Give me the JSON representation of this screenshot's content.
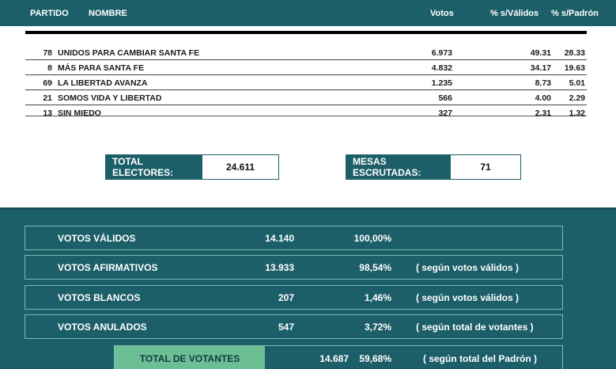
{
  "header": {
    "col_partido": "PARTIDO",
    "col_nombre": "NOMBRE",
    "col_votos": "Votos",
    "col_pct_validos": "% s/Válidos",
    "col_pct_padron": "% s/Padrón"
  },
  "results": [
    {
      "num": "78",
      "name": "UNIDOS PARA CAMBIAR SANTA FE",
      "votos": "6.973",
      "pct_validos": "49.31",
      "pct_padron": "28.33"
    },
    {
      "num": "8",
      "name": "MÁS PARA SANTA FE",
      "votos": "4.832",
      "pct_validos": "34.17",
      "pct_padron": "19.63"
    },
    {
      "num": "69",
      "name": "LA LIBERTAD AVANZA",
      "votos": "1.235",
      "pct_validos": "8.73",
      "pct_padron": "5.01"
    },
    {
      "num": "21",
      "name": "SOMOS VIDA Y LIBERTAD",
      "votos": "566",
      "pct_validos": "4.00",
      "pct_padron": "2.29"
    },
    {
      "num": "13",
      "name": "SIN MIEDO",
      "votos": "327",
      "pct_validos": "2.31",
      "pct_padron": "1.32"
    }
  ],
  "summary": {
    "total_electores_label": "TOTAL ELECTORES:",
    "total_electores_value": "24.611",
    "mesas_label": "MESAS ESCRUTADAS:",
    "mesas_value": "71"
  },
  "stats": [
    {
      "label": "VOTOS VÁLIDOS",
      "value": "14.140",
      "pct": "100,00%",
      "note": ""
    },
    {
      "label": "VOTOS AFIRMATIVOS",
      "value": "13.933",
      "pct": "98,54%",
      "note": "( según votos válidos )"
    },
    {
      "label": "VOTOS BLANCOS",
      "value": "207",
      "pct": "1,46%",
      "note": "( según votos válidos )"
    },
    {
      "label": "VOTOS ANULADOS",
      "value": "547",
      "pct": "3,72%",
      "note": "( según total de votantes )"
    }
  ],
  "total_votantes": {
    "label": "TOTAL DE VOTANTES",
    "value": "14.687",
    "pct": "59,68%",
    "note": "( según total del Padrón )"
  },
  "colors": {
    "header_bg": "#1c5f69",
    "total_label_bg": "#6cbf94",
    "row_border": "#7fb9b0"
  }
}
